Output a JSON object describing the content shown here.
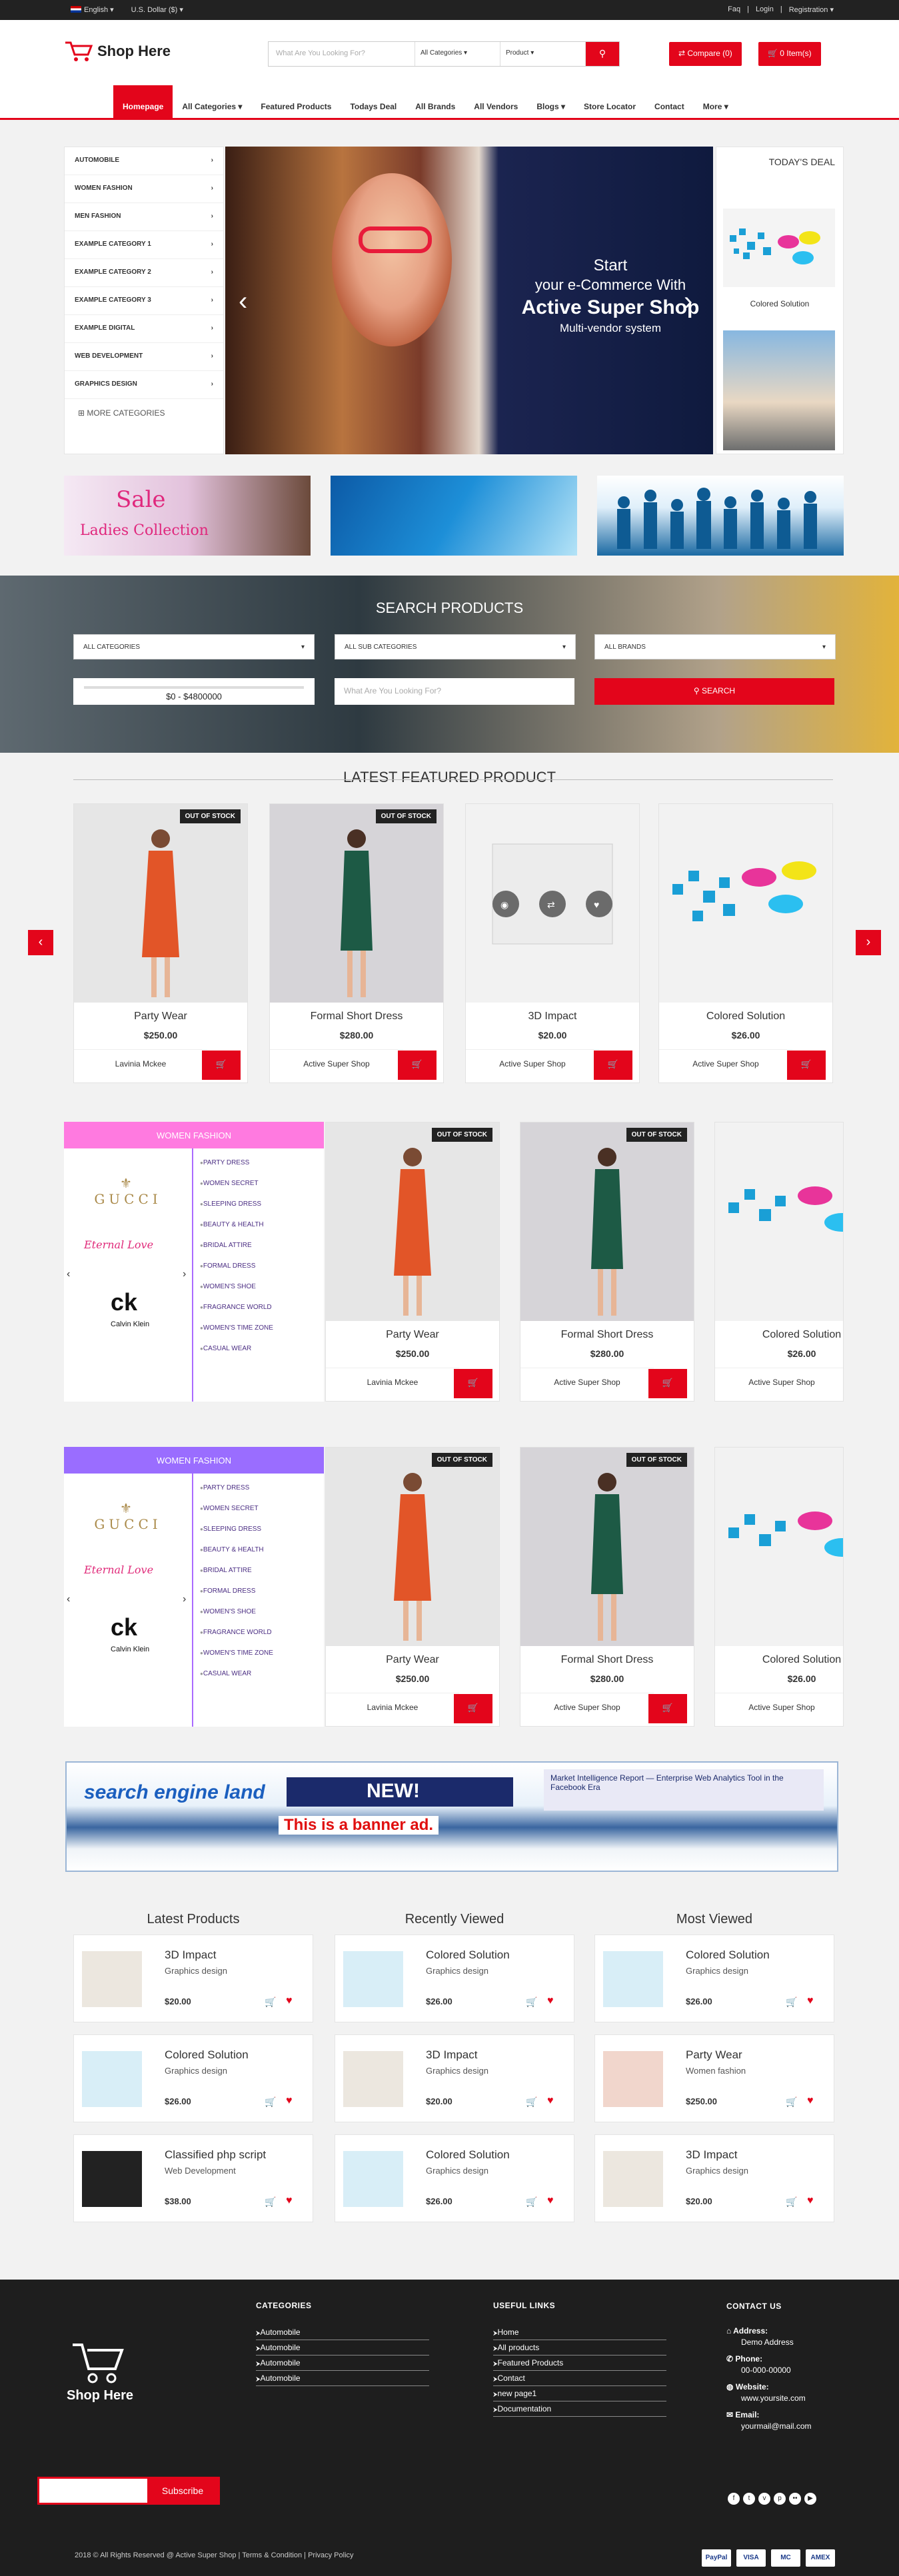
{
  "topbar": {
    "language": "English",
    "currency": "U.S. Dollar ($)",
    "links": [
      "Faq",
      "Login",
      "Registration"
    ]
  },
  "header": {
    "logo_text": "Shop Here",
    "search_placeholder": "What Are You Looking For?",
    "category_select": "All Categories",
    "type_select": "Product",
    "compare_label": "Compare (0)",
    "cart_label": "0 Item(s)"
  },
  "nav": [
    "Homepage",
    "All Categories",
    "Featured Products",
    "Todays Deal",
    "All Brands",
    "All Vendors",
    "Blogs",
    "Store Locator",
    "Contact",
    "More"
  ],
  "categories": [
    "AUTOMOBILE",
    "WOMEN FASHION",
    "MEN FASHION",
    "EXAMPLE CATEGORY 1",
    "EXAMPLE CATEGORY 2",
    "EXAMPLE CATEGORY 3",
    "EXAMPLE DIGITAL",
    "WEB DEVELOPMENT",
    "GRAPHICS DESIGN"
  ],
  "more_categories": "MORE CATEGORIES",
  "slider": {
    "line1": "Start",
    "line2": "your e-Commerce With",
    "line3": "Active Super Shop",
    "line4": "Multi-vendor system"
  },
  "todays_deal": {
    "title": "TODAY'S DEAL",
    "item": "Colored Solution"
  },
  "banner_sale": {
    "line1": "Sale",
    "line2": "Ladies Collection"
  },
  "search_products": {
    "title": "SEARCH PRODUCTS",
    "cat": "ALL CATEGORIES",
    "subcat": "ALL SUB CATEGORIES",
    "brands": "ALL BRANDS",
    "range": "$0 - $4800000",
    "keyword": "What Are You Looking For?",
    "button": "SEARCH"
  },
  "featured": {
    "title": "LATEST FEATURED PRODUCT",
    "items": [
      {
        "name": "Party Wear",
        "price": "$250.00",
        "vendor": "Lavinia Mckee",
        "oos": "OUT OF STOCK"
      },
      {
        "name": "Formal Short Dress",
        "price": "$280.00",
        "vendor": "Active Super Shop",
        "oos": "OUT OF STOCK"
      },
      {
        "name": "3D Impact",
        "price": "$20.00",
        "vendor": "Active Super Shop",
        "oos": ""
      },
      {
        "name": "Colored Solution",
        "price": "$26.00",
        "vendor": "Active Super Shop",
        "oos": ""
      }
    ]
  },
  "cat_block": {
    "title": "WOMEN FASHION",
    "brands": [
      "GUCCI",
      "Eternal Love",
      "ck",
      "Calvin Klein"
    ],
    "links": [
      "PARTY DRESS",
      "WOMEN SECRET",
      "SLEEPING DRESS",
      "BEAUTY & HEALTH",
      "BRIDAL ATTIRE",
      "FORMAL DRESS",
      "WOMEN'S SHOE",
      "FRAGRANCE WORLD",
      "WOMEN'S TIME ZONE",
      "CASUAL WEAR"
    ],
    "products": [
      {
        "name": "Party Wear",
        "price": "$250.00",
        "vendor": "Lavinia Mckee",
        "oos": "OUT OF STOCK"
      },
      {
        "name": "Formal Short Dress",
        "price": "$280.00",
        "vendor": "Active Super Shop",
        "oos": "OUT OF STOCK"
      },
      {
        "name": "Colored Solution",
        "price": "$26.00",
        "vendor": "Active Super Shop",
        "oos": ""
      }
    ],
    "colors": [
      "#ff7ae0",
      "#9a6dff"
    ]
  },
  "ad": {
    "brand": "search engine land",
    "new": "NEW!",
    "banner": "This is a banner ad.",
    "market": "Market Intelligence Report — Enterprise Web Analytics Tool in the Facebook Era"
  },
  "lists": [
    {
      "title": "Latest Products",
      "items": [
        {
          "name": "3D Impact",
          "cat": "Graphics design",
          "price": "$20.00"
        },
        {
          "name": "Colored Solution",
          "cat": "Graphics design",
          "price": "$26.00"
        },
        {
          "name": "Classified php script",
          "cat": "Web Development",
          "price": "$38.00"
        }
      ]
    },
    {
      "title": "Recently Viewed",
      "items": [
        {
          "name": "Colored Solution",
          "cat": "Graphics design",
          "price": "$26.00"
        },
        {
          "name": "3D Impact",
          "cat": "Graphics design",
          "price": "$20.00"
        },
        {
          "name": "Colored Solution",
          "cat": "Graphics design",
          "price": "$26.00"
        }
      ]
    },
    {
      "title": "Most Viewed",
      "items": [
        {
          "name": "Colored Solution",
          "cat": "Graphics design",
          "price": "$26.00"
        },
        {
          "name": "Party Wear",
          "cat": "Women fashion",
          "price": "$250.00"
        },
        {
          "name": "3D Impact",
          "cat": "Graphics design",
          "price": "$20.00"
        }
      ]
    }
  ],
  "footer": {
    "logo": "Shop Here",
    "categories_title": "CATEGORIES",
    "categories": [
      "Automobile",
      "Automobile",
      "Automobile",
      "Automobile"
    ],
    "links_title": "USEFUL LINKS",
    "links": [
      "Home",
      "All products",
      "Featured Products",
      "Contact",
      "new page1",
      "Documentation"
    ],
    "contact_title": "CONTACT US",
    "address_label": "Address:",
    "address": "Demo Address",
    "phone_label": "Phone:",
    "phone": "00-000-00000",
    "website_label": "Website:",
    "website": "www.yoursite.com",
    "email_label": "Email:",
    "email": "yourmail@mail.com",
    "subscribe": "Subscribe",
    "copyright": "2018 © All Rights Reserved @ Active Super Shop | Terms & Condition | Privacy Policy",
    "payments": [
      "PayPal",
      "VISA",
      "MC",
      "AMEX"
    ]
  }
}
